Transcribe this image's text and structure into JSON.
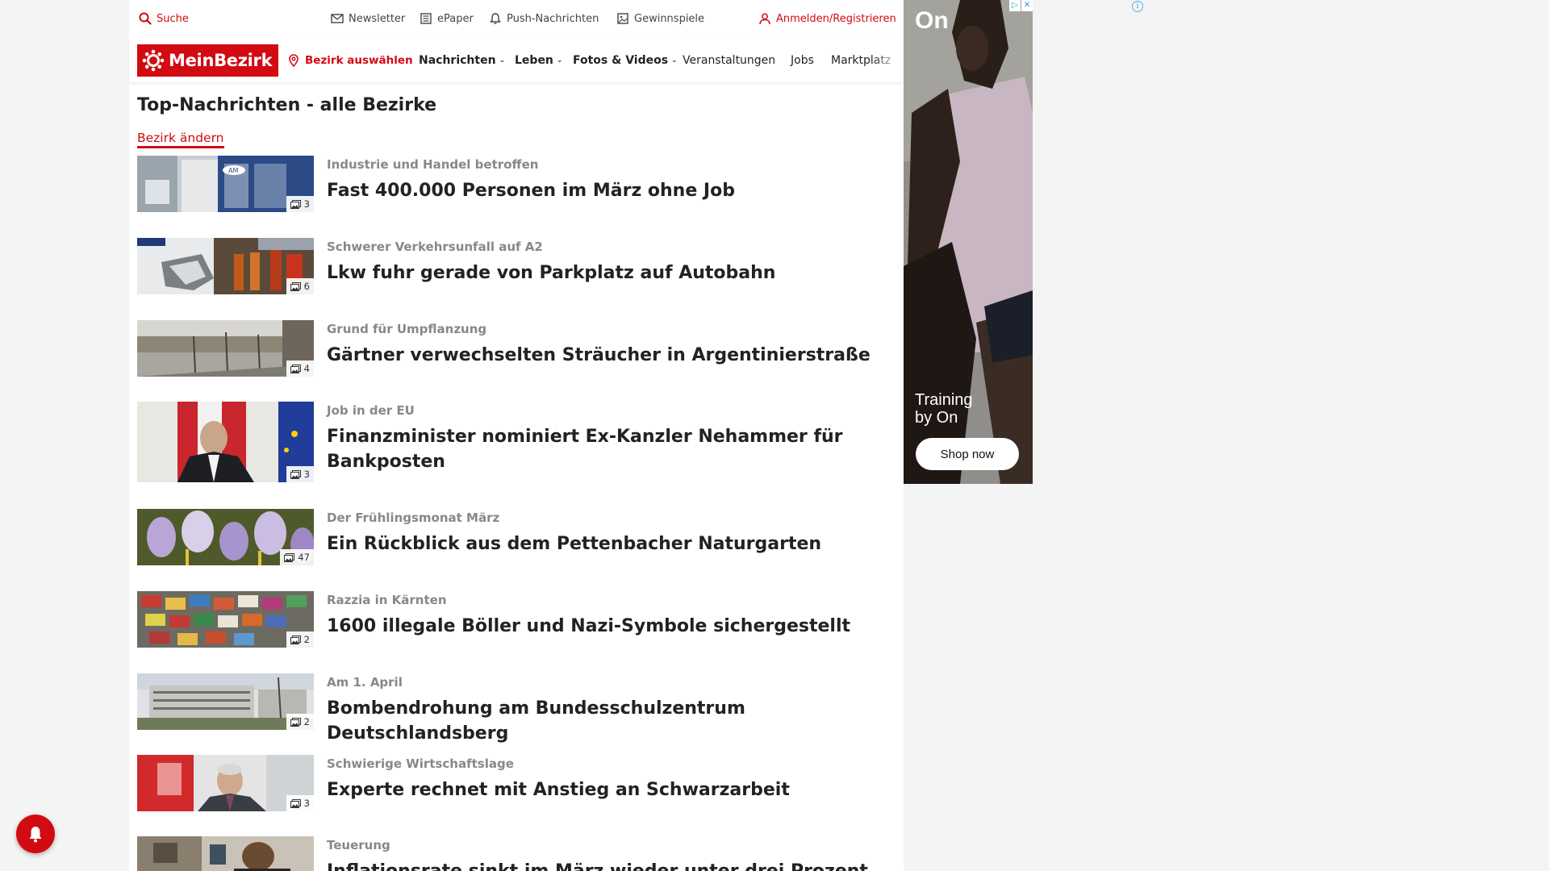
{
  "topbar": {
    "search": "Suche",
    "newsletter": "Newsletter",
    "epaper": "ePaper",
    "push": "Push-Nachrichten",
    "gewinnspiele": "Gewinnspiele",
    "login": "Anmelden/Registrieren"
  },
  "nav": {
    "logo": "MeinBezirk",
    "bezirk": "Bezirk auswählen",
    "links": [
      {
        "label": "Nachrichten",
        "dropdown": true
      },
      {
        "label": "Leben",
        "dropdown": true
      },
      {
        "label": "Fotos & Videos",
        "dropdown": true
      },
      {
        "label": "Veranstaltungen",
        "dropdown": false
      },
      {
        "label": "Jobs",
        "dropdown": false
      },
      {
        "label": "Marktplatz",
        "dropdown": false
      }
    ]
  },
  "section": {
    "title": "Top-Nachrichten - alle Bezirke",
    "change": "Bezirk ändern"
  },
  "articles": [
    {
      "kicker": "Industrie und Handel betroffen",
      "headline": "Fast 400.000 Personen im März ohne Job",
      "images": "3"
    },
    {
      "kicker": "Schwerer Verkehrsunfall auf A2",
      "headline": "Lkw fuhr gerade von Parkplatz auf Autobahn",
      "images": "6"
    },
    {
      "kicker": "Grund für Umpflanzung",
      "headline": "Gärtner verwechselten Sträucher in Argentinierstraße",
      "images": "4"
    },
    {
      "kicker": "Job in der EU",
      "headline": "Finanzminister nominiert Ex-Kanzler Nehammer für Bankposten",
      "images": "3"
    },
    {
      "kicker": "Der Frühlingsmonat März",
      "headline": "Ein Rückblick aus dem Pettenbacher Naturgarten",
      "images": "47"
    },
    {
      "kicker": "Razzia in Kärnten",
      "headline": "1600 illegale Böller und Nazi-Symbole sichergestellt",
      "images": "2"
    },
    {
      "kicker": "Am 1. April",
      "headline": "Bombendrohung am Bundesschulzentrum Deutschlandsberg",
      "images": "2"
    },
    {
      "kicker": "Schwierige Wirtschaftslage",
      "headline": "Experte rechnet mit Anstieg an Schwarzarbeit",
      "images": "3"
    },
    {
      "kicker": "Teuerung",
      "headline": "Inflationsrate sinkt im März wieder unter drei Prozent",
      "images": ""
    }
  ],
  "ad": {
    "brand": "On",
    "tagline_1": "Training",
    "tagline_2": "by On",
    "cta": "Shop now"
  },
  "colors": {
    "brand": "#d20a11"
  }
}
